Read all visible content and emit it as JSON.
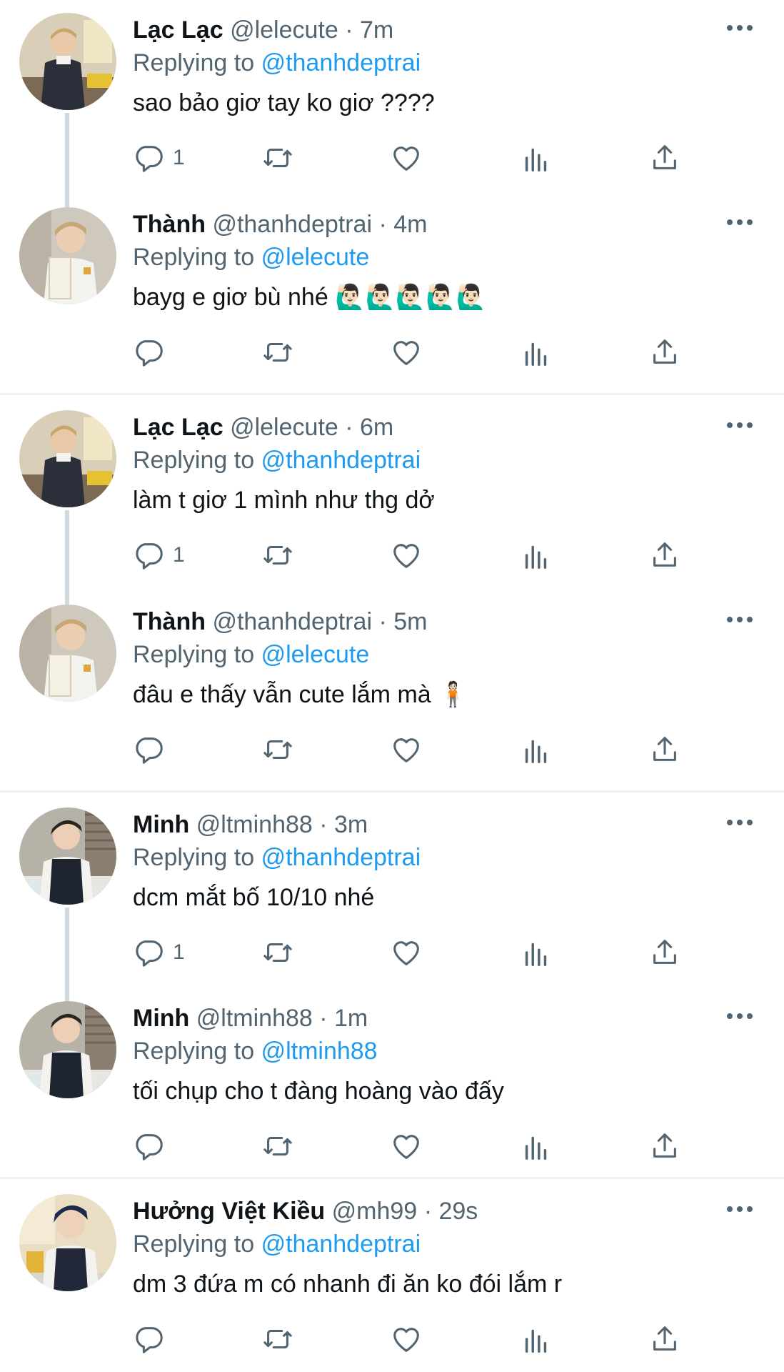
{
  "tweets": [
    {
      "name": "Lạc Lạc",
      "handle": "@lelecute",
      "time": "· 7m",
      "replying_prefix": "Replying to",
      "replying_to": "@thanhdeptrai",
      "text": "sao bảo giơ tay ko giơ ????",
      "reply_count": "1",
      "avatar": "lac-lac-avatar"
    },
    {
      "name": "Thành",
      "handle": "@thanhdeptrai",
      "time": "· 4m",
      "replying_prefix": "Replying to",
      "replying_to": "@lelecute",
      "text": "bayg e  giơ bù nhé 🙋🏻‍♂️🙋🏻‍♂️🙋🏻‍♂️🙋🏻‍♂️🙋🏻‍♂️",
      "reply_count": "",
      "avatar": "thanh-avatar"
    },
    {
      "name": "Lạc Lạc",
      "handle": "@lelecute",
      "time": "· 6m",
      "replying_prefix": "Replying to",
      "replying_to": "@thanhdeptrai",
      "text": "làm t giơ 1 mình như thg dở",
      "reply_count": "1",
      "avatar": "lac-lac-avatar"
    },
    {
      "name": "Thành",
      "handle": "@thanhdeptrai",
      "time": "· 5m",
      "replying_prefix": "Replying to",
      "replying_to": "@lelecute",
      "text": "đâu e thấy vẫn cute lắm mà 🧍🏻",
      "reply_count": "",
      "avatar": "thanh-avatar"
    },
    {
      "name": "Minh",
      "handle": "@ltminh88",
      "time": "· 3m",
      "replying_prefix": "Replying to",
      "replying_to": "@thanhdeptrai",
      "text": "dcm mắt bố 10/10 nhé",
      "reply_count": "1",
      "avatar": "minh-avatar"
    },
    {
      "name": "Minh",
      "handle": "@ltminh88",
      "time": "· 1m",
      "replying_prefix": "Replying to",
      "replying_to": "@ltminh88",
      "text": "tối chụp cho t đàng hoàng vào đấy",
      "reply_count": "",
      "avatar": "minh-avatar"
    },
    {
      "name": "Hưởng Việt Kiều",
      "handle": "@mh99",
      "time": "· 29s",
      "replying_prefix": "Replying to",
      "replying_to": "@thanhdeptrai",
      "text": "dm 3 đứa m có nhanh đi ăn ko đói lắm r",
      "reply_count": "",
      "avatar": "huong-avatar"
    }
  ],
  "icons": {
    "reply": "reply-icon",
    "retweet": "retweet-icon",
    "like": "heart-icon",
    "views": "views-icon",
    "share": "share-icon",
    "more": "more-icon"
  },
  "colors": {
    "text": "#0f1419",
    "secondary": "#536471",
    "mention": "#1d9bf0",
    "divider": "#eff3f4",
    "thread_line": "#cfd9de"
  }
}
